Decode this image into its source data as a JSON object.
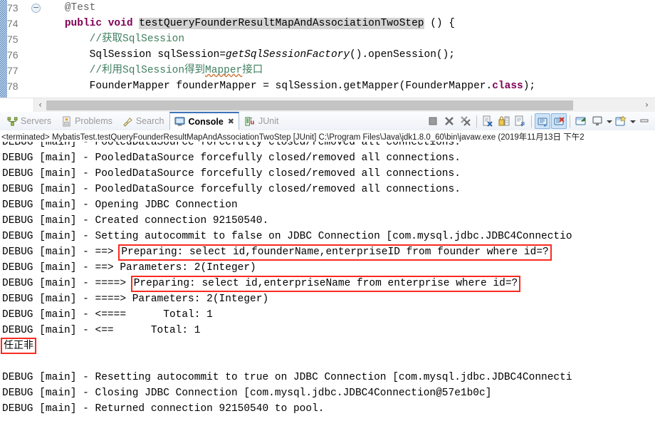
{
  "editor": {
    "lines": [
      {
        "num": "73",
        "fold": true,
        "segments": [
          {
            "t": "    ",
            "c": "pl"
          },
          {
            "t": "@Test",
            "c": "ann"
          }
        ]
      },
      {
        "num": "74",
        "fold": false,
        "segments": [
          {
            "t": "    ",
            "c": "pl"
          },
          {
            "t": "public void ",
            "c": "kw"
          },
          {
            "t": "testQueryFounderResultMapAndAssociationTwoStep",
            "c": "sel"
          },
          {
            "t": " () {",
            "c": "pl"
          }
        ]
      },
      {
        "num": "75",
        "fold": false,
        "segments": [
          {
            "t": "        ",
            "c": "pl"
          },
          {
            "t": "//获取SqlSession",
            "c": "cm"
          }
        ]
      },
      {
        "num": "76",
        "fold": false,
        "segments": [
          {
            "t": "        SqlSession sqlSession=",
            "c": "pl"
          },
          {
            "t": "getSqlSessionFactory",
            "c": "mth"
          },
          {
            "t": "().openSession();",
            "c": "pl"
          }
        ]
      },
      {
        "num": "77",
        "fold": false,
        "segments": [
          {
            "t": "        ",
            "c": "pl"
          },
          {
            "t": "//利用SqlSession得到",
            "c": "cm"
          },
          {
            "t": "Mapper",
            "c": "cm squig"
          },
          {
            "t": "接口",
            "c": "cm"
          }
        ]
      },
      {
        "num": "78",
        "fold": false,
        "segments": [
          {
            "t": "        FounderMapper founderMapper = sqlSession.getMapper(FounderMapper.",
            "c": "pl"
          },
          {
            "t": "class",
            "c": "kw"
          },
          {
            "t": ");",
            "c": "pl"
          }
        ]
      }
    ],
    "hscroll": {
      "left_arrow": "‹",
      "right_arrow": "›"
    }
  },
  "tabs": [
    {
      "label": "Servers",
      "icon": "servers-icon",
      "active": false,
      "closable": false
    },
    {
      "label": "Problems",
      "icon": "problems-icon",
      "active": false,
      "closable": false
    },
    {
      "label": "Search",
      "icon": "search-icon",
      "active": false,
      "closable": false
    },
    {
      "label": "Console",
      "icon": "console-icon",
      "active": true,
      "closable": true,
      "close_glyph": "✖"
    },
    {
      "label": "JUnit",
      "icon": "junit-icon",
      "active": false,
      "closable": false
    }
  ],
  "toolbar": {
    "buttons": [
      {
        "name": "terminate-button",
        "icon": "stop-square-icon"
      },
      {
        "name": "remove-launch-button",
        "icon": "x-gray-icon"
      },
      {
        "name": "remove-all-terminated-button",
        "icon": "xx-gray-icon"
      },
      {
        "name": "clear-console-button",
        "icon": "clear-console-icon"
      },
      {
        "name": "scroll-lock-button",
        "icon": "lock-icon"
      },
      {
        "name": "word-wrap-button",
        "icon": "wrap-icon"
      },
      {
        "name": "show-console-on-output-button",
        "icon": "console-out-icon",
        "pressed": true
      },
      {
        "name": "show-console-on-error-button",
        "icon": "console-err-icon",
        "pressed": true
      },
      {
        "name": "pin-console-button",
        "icon": "pin-console-icon"
      },
      {
        "name": "display-selected-console-button",
        "icon": "display-console-icon"
      },
      {
        "name": "open-console-button",
        "icon": "new-console-icon"
      },
      {
        "name": "minimize-button",
        "icon": "minimize-icon"
      }
    ],
    "caret_glyph": "▾"
  },
  "console": {
    "terminated_line": "<terminated> MybatisTest.testQueryFounderResultMapAndAssociationTwoStep [JUnit] C:\\Program Files\\Java\\jdk1.8.0_60\\bin\\javaw.exe (2019年11月13日 下午2",
    "lines": [
      {
        "text": "DEBUG [main] - PooledDataSource forcefully closed/removed all connections.",
        "clipped": true
      },
      {
        "text": "DEBUG [main] - PooledDataSource forcefully closed/removed all connections."
      },
      {
        "text": "DEBUG [main] - PooledDataSource forcefully closed/removed all connections."
      },
      {
        "text": "DEBUG [main] - PooledDataSource forcefully closed/removed all connections."
      },
      {
        "text": "DEBUG [main] - PooledDataSource forcefully closed/removed all connections."
      },
      {
        "text": "DEBUG [main] - Opening JDBC Connection"
      },
      {
        "text": "DEBUG [main] - Created connection 92150540."
      },
      {
        "text": "DEBUG [main] - Setting autocommit to false on JDBC Connection [com.mysql.jdbc.JDBC4Connectio"
      },
      {
        "prefix": "DEBUG [main] - ==> ",
        "boxed": "Preparing: select id,founderName,enterpriseID from founder where id=?"
      },
      {
        "text": "DEBUG [main] - ==> Parameters: 2(Integer)"
      },
      {
        "prefix": "DEBUG [main] - ====> ",
        "boxed": "Preparing: select id,enterpriseName from enterprise where id=?"
      },
      {
        "text": "DEBUG [main] - ====> Parameters: 2(Integer)"
      },
      {
        "text": "DEBUG [main] - <====      Total: 1"
      },
      {
        "text": "DEBUG [main] - <==      Total: 1"
      },
      {
        "prefix": "",
        "boxed": "任正非",
        "cjk": true
      },
      {
        "text": ""
      },
      {
        "text": "DEBUG [main] - Resetting autocommit to true on JDBC Connection [com.mysql.jdbc.JDBC4Connecti"
      },
      {
        "text": "DEBUG [main] - Closing JDBC Connection [com.mysql.jdbc.JDBC4Connection@57e1b0c]"
      },
      {
        "text": "DEBUG [main] - Returned connection 92150540 to pool."
      }
    ]
  },
  "colors": {
    "highlight_box": "#fa2b20",
    "keyword": "#7f0055",
    "comment": "#3f7f5f",
    "selection": "#d4d4d4",
    "tab_active_underline": "#3b73b9"
  }
}
